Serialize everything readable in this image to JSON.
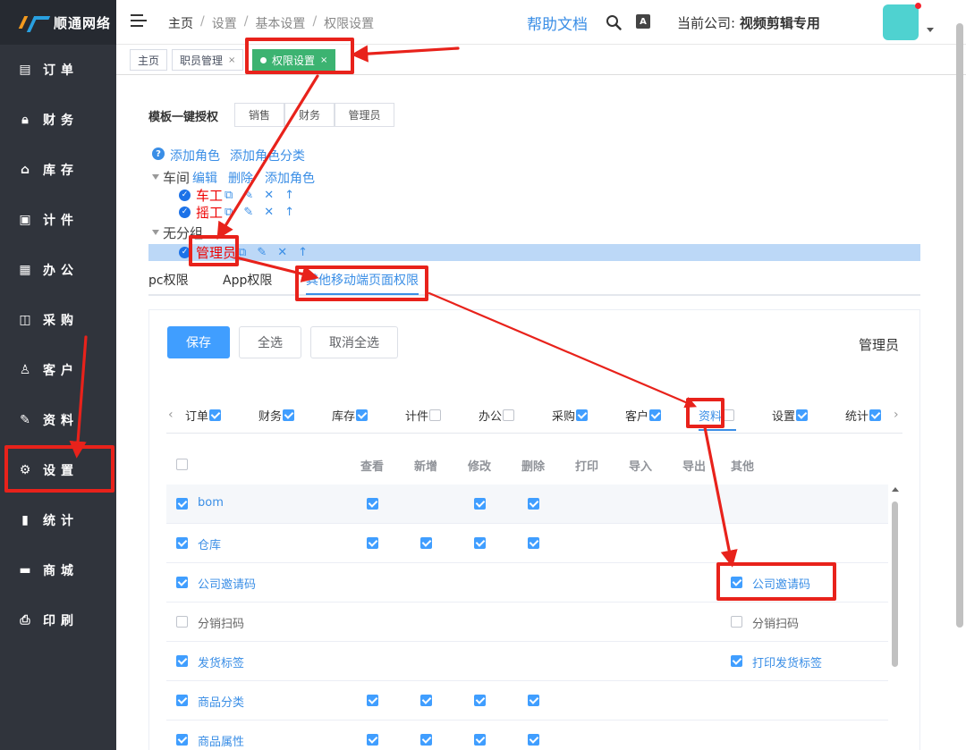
{
  "brand": "顺通网络",
  "sidebar": {
    "items": [
      {
        "label": "订单",
        "icon": "order-icon"
      },
      {
        "label": "财务",
        "icon": "lock-icon"
      },
      {
        "label": "库存",
        "icon": "home-icon"
      },
      {
        "label": "计件",
        "icon": "clipboard-icon"
      },
      {
        "label": "办公",
        "icon": "calendar-icon"
      },
      {
        "label": "采购",
        "icon": "bag-icon"
      },
      {
        "label": "客户",
        "icon": "user-icon"
      },
      {
        "label": "资料",
        "icon": "pen-icon"
      },
      {
        "label": "设置",
        "icon": "gear-icon"
      },
      {
        "label": "统计",
        "icon": "bar-chart-icon"
      },
      {
        "label": "商城",
        "icon": "shop-icon"
      },
      {
        "label": "印刷",
        "icon": "printer-icon"
      }
    ]
  },
  "header": {
    "breadcrumbs": [
      "主页",
      "设置",
      "基本设置",
      "权限设置"
    ],
    "help": "帮助文档",
    "company_label": "当前公司:",
    "company_name": "视频剪辑专用"
  },
  "tabs": [
    {
      "label": "主页",
      "closable": false
    },
    {
      "label": "职员管理",
      "closable": true
    },
    {
      "label": "权限设置",
      "closable": true,
      "active": true
    }
  ],
  "template": {
    "label": "模板一键授权",
    "buttons": [
      "销售",
      "财务",
      "管理员"
    ]
  },
  "tree": {
    "add_role": "添加角色",
    "add_category": "添加角色分类",
    "groups": [
      {
        "name": "车间",
        "actions": [
          "编辑",
          "删除",
          "添加角色"
        ],
        "roles": [
          "车工",
          "摇工"
        ]
      },
      {
        "name": "无分组",
        "roles": [
          "管理员"
        ]
      }
    ]
  },
  "perm_tabs": [
    "pc权限",
    "App权限",
    "其他移动端页面权限"
  ],
  "actions": {
    "save": "保存",
    "select_all": "全选",
    "deselect_all": "取消全选"
  },
  "role_title": "管理员",
  "categories": [
    {
      "label": "订单",
      "checked": true
    },
    {
      "label": "财务",
      "checked": true
    },
    {
      "label": "库存",
      "checked": true
    },
    {
      "label": "计件",
      "checked": false
    },
    {
      "label": "办公",
      "checked": false
    },
    {
      "label": "采购",
      "checked": true
    },
    {
      "label": "客户",
      "checked": true
    },
    {
      "label": "资料",
      "checked": false,
      "active": true
    },
    {
      "label": "设置",
      "checked": true
    },
    {
      "label": "统计",
      "checked": true
    }
  ],
  "table": {
    "columns": [
      "查看",
      "新增",
      "修改",
      "删除",
      "打印",
      "导入",
      "导出",
      "其他"
    ],
    "rows": [
      {
        "name": "bom",
        "checked": true,
        "perms": [
          true,
          false,
          true,
          true
        ],
        "other": null
      },
      {
        "name": "仓库",
        "checked": true,
        "perms": [
          true,
          true,
          true,
          true
        ],
        "other": null
      },
      {
        "name": "公司邀请码",
        "checked": true,
        "perms": [
          false,
          false,
          false,
          false
        ],
        "other": {
          "label": "公司邀请码",
          "checked": true
        }
      },
      {
        "name": "分销扫码",
        "checked": false,
        "perms": [
          false,
          false,
          false,
          false
        ],
        "other": {
          "label": "分销扫码",
          "checked": false
        }
      },
      {
        "name": "发货标签",
        "checked": true,
        "perms": [
          false,
          false,
          false,
          false
        ],
        "other": {
          "label": "打印发货标签",
          "checked": true
        }
      },
      {
        "name": "商品分类",
        "checked": true,
        "perms": [
          true,
          true,
          true,
          true
        ],
        "other": null
      },
      {
        "name": "商品属性",
        "checked": true,
        "perms": [
          true,
          true,
          true,
          true
        ],
        "other": null
      }
    ]
  },
  "colors": {
    "accent": "#409eff",
    "sidebar": "#30343c",
    "tab_active": "#3cb371",
    "annotation": "#e8221b"
  }
}
